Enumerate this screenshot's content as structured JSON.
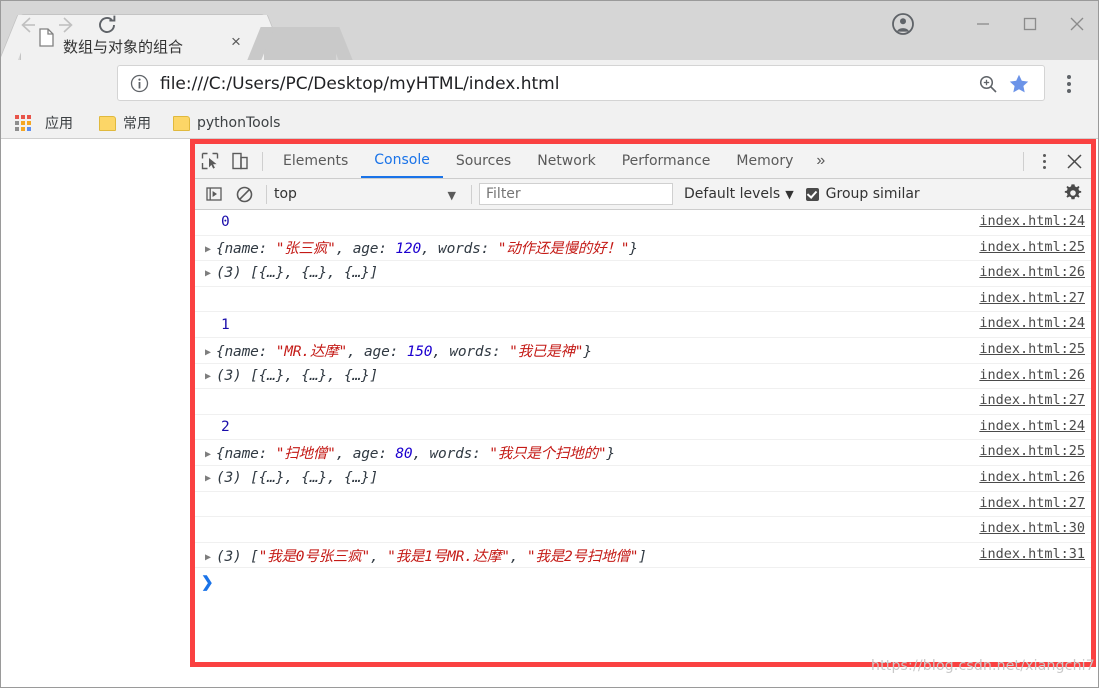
{
  "browser": {
    "tab": {
      "title": "数组与对象的组合",
      "favicon": "page-icon",
      "close": "×"
    },
    "nav": {
      "back": "back-arrow-icon",
      "forward": "forward-arrow-icon",
      "reload": "reload-icon"
    },
    "omnibox": {
      "url": "file:///C:/Users/PC/Desktop/myHTML/index.html",
      "info_icon": "info-circle-icon",
      "zoom_icon": "zoom-in-icon",
      "star_icon": "bookmark-star-icon"
    },
    "menu_icon": "three-dot-menu-icon",
    "window_controls": {
      "profile": "profile-avatar-icon",
      "minimize": "—",
      "maximize": "□",
      "close": "✕"
    },
    "bookmarks": {
      "apps_icon": "apps-grid-icon",
      "items": [
        {
          "label": "应用",
          "icon": "apps-grid-icon"
        },
        {
          "label": "常用",
          "icon": "folder-icon"
        },
        {
          "label": "pythonTools",
          "icon": "folder-icon"
        }
      ]
    }
  },
  "devtools": {
    "inspect_icon": "inspect-element-icon",
    "device_icon": "device-toolbar-icon",
    "tabs": [
      {
        "label": "Elements",
        "active": false
      },
      {
        "label": "Console",
        "active": true
      },
      {
        "label": "Sources",
        "active": false
      },
      {
        "label": "Network",
        "active": false
      },
      {
        "label": "Performance",
        "active": false
      },
      {
        "label": "Memory",
        "active": false
      }
    ],
    "more_tabs": "»",
    "kebab_icon": "more-options-icon",
    "close_icon": "close-devtools-icon",
    "console_toolbar": {
      "execute_icon": "execute-sidebar-icon",
      "clear_icon": "clear-console-icon",
      "context": "top",
      "context_caret": "▼",
      "filter_placeholder": "Filter",
      "filter_value": "",
      "levels_label": "Default levels",
      "levels_caret": "▼",
      "group_similar_label": "Group similar",
      "group_similar_checked": true,
      "settings_icon": "gear-icon"
    },
    "console_rows": [
      {
        "type": "index",
        "arrow": false,
        "text": "0",
        "src": "index.html:24"
      },
      {
        "type": "object",
        "arrow": true,
        "prefix": "{name: ",
        "str1": "\"张三疯\"",
        "mid": ", age: ",
        "num": "120",
        "mid2": ", words: ",
        "str2": "\"动作还是慢的好！\"",
        "suffix": "}",
        "src": "index.html:25"
      },
      {
        "type": "array",
        "arrow": true,
        "text": "(3) [{…}, {…}, {…}]",
        "src": "index.html:26"
      },
      {
        "type": "blank",
        "arrow": false,
        "text": "",
        "src": "index.html:27"
      },
      {
        "type": "index",
        "arrow": false,
        "text": "1",
        "src": "index.html:24"
      },
      {
        "type": "object",
        "arrow": true,
        "prefix": "{name: ",
        "str1": "\"MR.达摩\"",
        "mid": ", age: ",
        "num": "150",
        "mid2": ", words: ",
        "str2": "\"我已是神\"",
        "suffix": "}",
        "src": "index.html:25"
      },
      {
        "type": "array",
        "arrow": true,
        "text": "(3) [{…}, {…}, {…}]",
        "src": "index.html:26"
      },
      {
        "type": "blank",
        "arrow": false,
        "text": "",
        "src": "index.html:27"
      },
      {
        "type": "index",
        "arrow": false,
        "text": "2",
        "src": "index.html:24"
      },
      {
        "type": "object",
        "arrow": true,
        "prefix": "{name: ",
        "str1": "\"扫地僧\"",
        "mid": ", age: ",
        "num": "80",
        "mid2": ", words: ",
        "str2": "\"我只是个扫地的\"",
        "suffix": "}",
        "src": "index.html:25"
      },
      {
        "type": "array",
        "arrow": true,
        "text": "(3) [{…}, {…}, {…}]",
        "src": "index.html:26"
      },
      {
        "type": "blank",
        "arrow": false,
        "text": "",
        "src": "index.html:27"
      },
      {
        "type": "blank",
        "arrow": false,
        "text": "",
        "src": "index.html:30"
      },
      {
        "type": "strarray",
        "arrow": true,
        "prefix": "(3) [",
        "str1": "\"我是0号张三疯\"",
        "mid": ", ",
        "str2": "\"我是1号MR.达摩\"",
        "mid2": ", ",
        "str3": "\"我是2号扫地僧\"",
        "suffix": "]",
        "src": "index.html:31"
      }
    ],
    "prompt_caret": "❯"
  },
  "watermark": "https://blog.csdn.net/xiangchi7",
  "colors": {
    "accent": "#1a73e8",
    "highlight_border": "#fa4141",
    "string": "#c41a16",
    "number": "#1c00cf",
    "index": "#1a0dab"
  }
}
